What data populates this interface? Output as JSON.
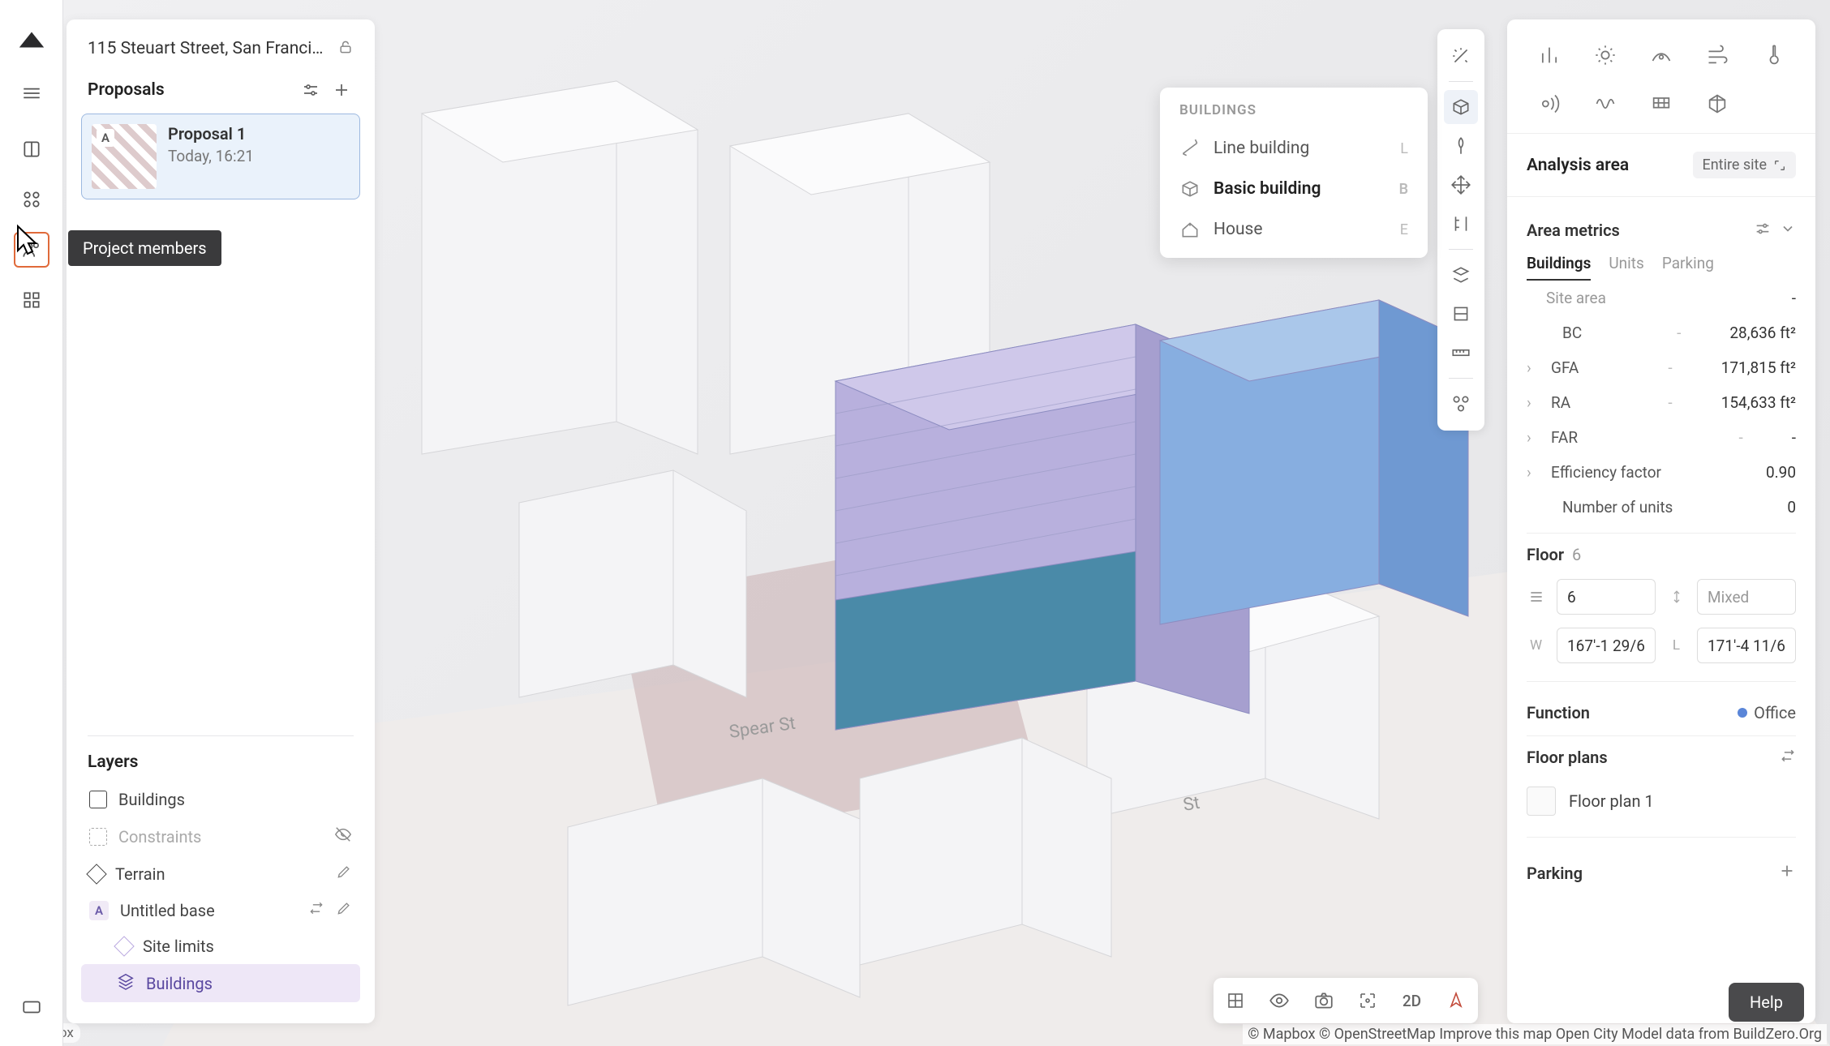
{
  "project_title": "115 Steuart Street, San Francisco, …",
  "tooltip": "Project members",
  "proposals": {
    "heading": "Proposals",
    "card": {
      "letter": "A",
      "name": "Proposal 1",
      "time": "Today, 16:21"
    }
  },
  "layers": {
    "heading": "Layers",
    "items": {
      "buildings": "Buildings",
      "constraints": "Constraints",
      "terrain": "Terrain",
      "base_letter": "A",
      "base": "Untitled base",
      "site_limits": "Site limits",
      "buildings2": "Buildings"
    }
  },
  "buildings_popup": {
    "title": "BUILDINGS",
    "rows": [
      {
        "label": "Line building",
        "key": "L"
      },
      {
        "label": "Basic building",
        "key": "B"
      },
      {
        "label": "House",
        "key": "E"
      }
    ]
  },
  "right": {
    "analysis_area": "Analysis area",
    "scope": "Entire site",
    "area_metrics": "Area metrics",
    "tabs": {
      "buildings": "Buildings",
      "units": "Units",
      "parking": "Parking"
    },
    "metrics": {
      "site_area": {
        "label": "Site area",
        "value": "-"
      },
      "bc": {
        "label": "BC",
        "dash": "-",
        "value": "28,636 ft²"
      },
      "gfa": {
        "label": "GFA",
        "dash": "-",
        "value": "171,815 ft²"
      },
      "ra": {
        "label": "RA",
        "dash": "-",
        "value": "154,633 ft²"
      },
      "far": {
        "label": "FAR",
        "dash": "-",
        "value": "-"
      },
      "eff": {
        "label": "Efficiency factor",
        "value": "0.90"
      },
      "units": {
        "label": "Number of units",
        "value": "0"
      }
    },
    "floor": {
      "label": "Floor",
      "count": "6",
      "floors_value": "6",
      "height_value": "Mixed",
      "w_label": "W",
      "w_value": "167'-1 29/6",
      "l_label": "L",
      "l_value": "171'-4 11/6"
    },
    "function": {
      "label": "Function",
      "value": "Office"
    },
    "floor_plans": {
      "label": "Floor plans",
      "item": "Floor plan 1"
    },
    "parking": "Parking"
  },
  "bottom": {
    "twoD": "2D"
  },
  "help": "Help",
  "mapbox": "© mapbox",
  "attribution": "© Mapbox  © OpenStreetMap  Improve this map  Open City Model data from BuildZero.Org"
}
